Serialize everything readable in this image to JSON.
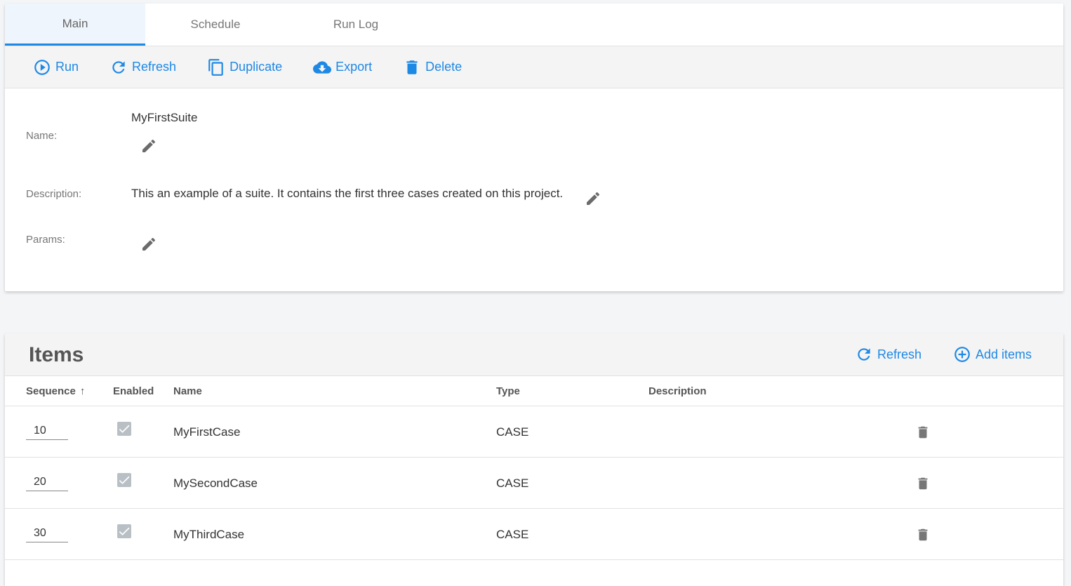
{
  "tabs": [
    {
      "label": "Main",
      "active": true
    },
    {
      "label": "Schedule",
      "active": false
    },
    {
      "label": "Run Log",
      "active": false
    }
  ],
  "toolbar": {
    "run": "Run",
    "refresh": "Refresh",
    "duplicate": "Duplicate",
    "export": "Export",
    "delete": "Delete"
  },
  "details": {
    "name_label": "Name:",
    "name_value": "MyFirstSuite",
    "description_label": "Description:",
    "description_value": "This an example of a suite. It contains the first three cases created on this project.",
    "params_label": "Params:"
  },
  "items": {
    "title": "Items",
    "refresh": "Refresh",
    "add_items": "Add items",
    "columns": {
      "sequence": "Sequence",
      "enabled": "Enabled",
      "name": "Name",
      "type": "Type",
      "description": "Description"
    },
    "rows": [
      {
        "sequence": "10",
        "enabled": true,
        "name": "MyFirstCase",
        "type": "CASE",
        "description": ""
      },
      {
        "sequence": "20",
        "enabled": true,
        "name": "MySecondCase",
        "type": "CASE",
        "description": ""
      },
      {
        "sequence": "30",
        "enabled": true,
        "name": "MyThirdCase",
        "type": "CASE",
        "description": ""
      }
    ]
  },
  "colors": {
    "accent": "#1e88e5",
    "checkbox_disabled": "#b9c0c5"
  }
}
